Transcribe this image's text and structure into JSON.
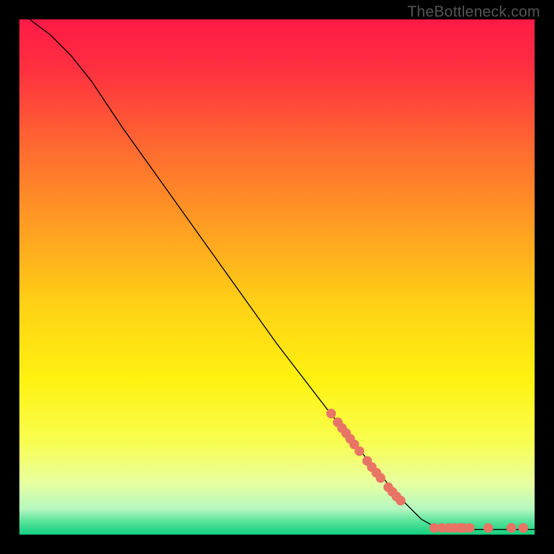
{
  "watermark": "TheBottleneck.com",
  "chart_data": {
    "type": "line",
    "title": "",
    "xlabel": "",
    "ylabel": "",
    "xlim": [
      0,
      100
    ],
    "ylim": [
      0,
      100
    ],
    "gradient_stops": [
      {
        "offset": 0.0,
        "color": "#ff1a46"
      },
      {
        "offset": 0.1,
        "color": "#ff3140"
      },
      {
        "offset": 0.25,
        "color": "#ff6a30"
      },
      {
        "offset": 0.4,
        "color": "#ff9d22"
      },
      {
        "offset": 0.55,
        "color": "#ffd015"
      },
      {
        "offset": 0.7,
        "color": "#fff210"
      },
      {
        "offset": 0.82,
        "color": "#f8fe50"
      },
      {
        "offset": 0.9,
        "color": "#e8ffa0"
      },
      {
        "offset": 0.95,
        "color": "#b5f7c0"
      },
      {
        "offset": 0.975,
        "color": "#55e39a"
      },
      {
        "offset": 1.0,
        "color": "#13cf7e"
      }
    ],
    "curve": [
      {
        "x": 2,
        "y": 100
      },
      {
        "x": 6,
        "y": 97
      },
      {
        "x": 10,
        "y": 93
      },
      {
        "x": 14,
        "y": 88
      },
      {
        "x": 20,
        "y": 79
      },
      {
        "x": 30,
        "y": 65
      },
      {
        "x": 40,
        "y": 51
      },
      {
        "x": 50,
        "y": 37
      },
      {
        "x": 60,
        "y": 24
      },
      {
        "x": 68,
        "y": 14
      },
      {
        "x": 74,
        "y": 7
      },
      {
        "x": 78,
        "y": 3
      },
      {
        "x": 81,
        "y": 1.3
      },
      {
        "x": 84,
        "y": 1.0
      },
      {
        "x": 90,
        "y": 1.0
      },
      {
        "x": 100,
        "y": 1.0
      }
    ],
    "marker_color": "#e87466",
    "marker_radius": 7,
    "markers": [
      {
        "x": 60.5,
        "y": 23.5
      },
      {
        "x": 61.8,
        "y": 21.8
      },
      {
        "x": 62.6,
        "y": 20.7
      },
      {
        "x": 63.4,
        "y": 19.7
      },
      {
        "x": 64.2,
        "y": 18.6
      },
      {
        "x": 65.0,
        "y": 17.5
      },
      {
        "x": 66.0,
        "y": 16.2
      },
      {
        "x": 67.5,
        "y": 14.3
      },
      {
        "x": 68.4,
        "y": 13.1
      },
      {
        "x": 69.3,
        "y": 12.0
      },
      {
        "x": 70.1,
        "y": 11.0
      },
      {
        "x": 71.6,
        "y": 9.2
      },
      {
        "x": 72.4,
        "y": 8.3
      },
      {
        "x": 73.2,
        "y": 7.4
      },
      {
        "x": 74.0,
        "y": 6.6
      },
      {
        "x": 80.5,
        "y": 1.3
      },
      {
        "x": 82.0,
        "y": 1.3
      },
      {
        "x": 83.3,
        "y": 1.3
      },
      {
        "x": 84.4,
        "y": 1.3
      },
      {
        "x": 85.5,
        "y": 1.3
      },
      {
        "x": 86.2,
        "y": 1.3
      },
      {
        "x": 87.4,
        "y": 1.3
      },
      {
        "x": 91.0,
        "y": 1.3
      },
      {
        "x": 95.5,
        "y": 1.3
      },
      {
        "x": 97.8,
        "y": 1.3
      }
    ]
  }
}
